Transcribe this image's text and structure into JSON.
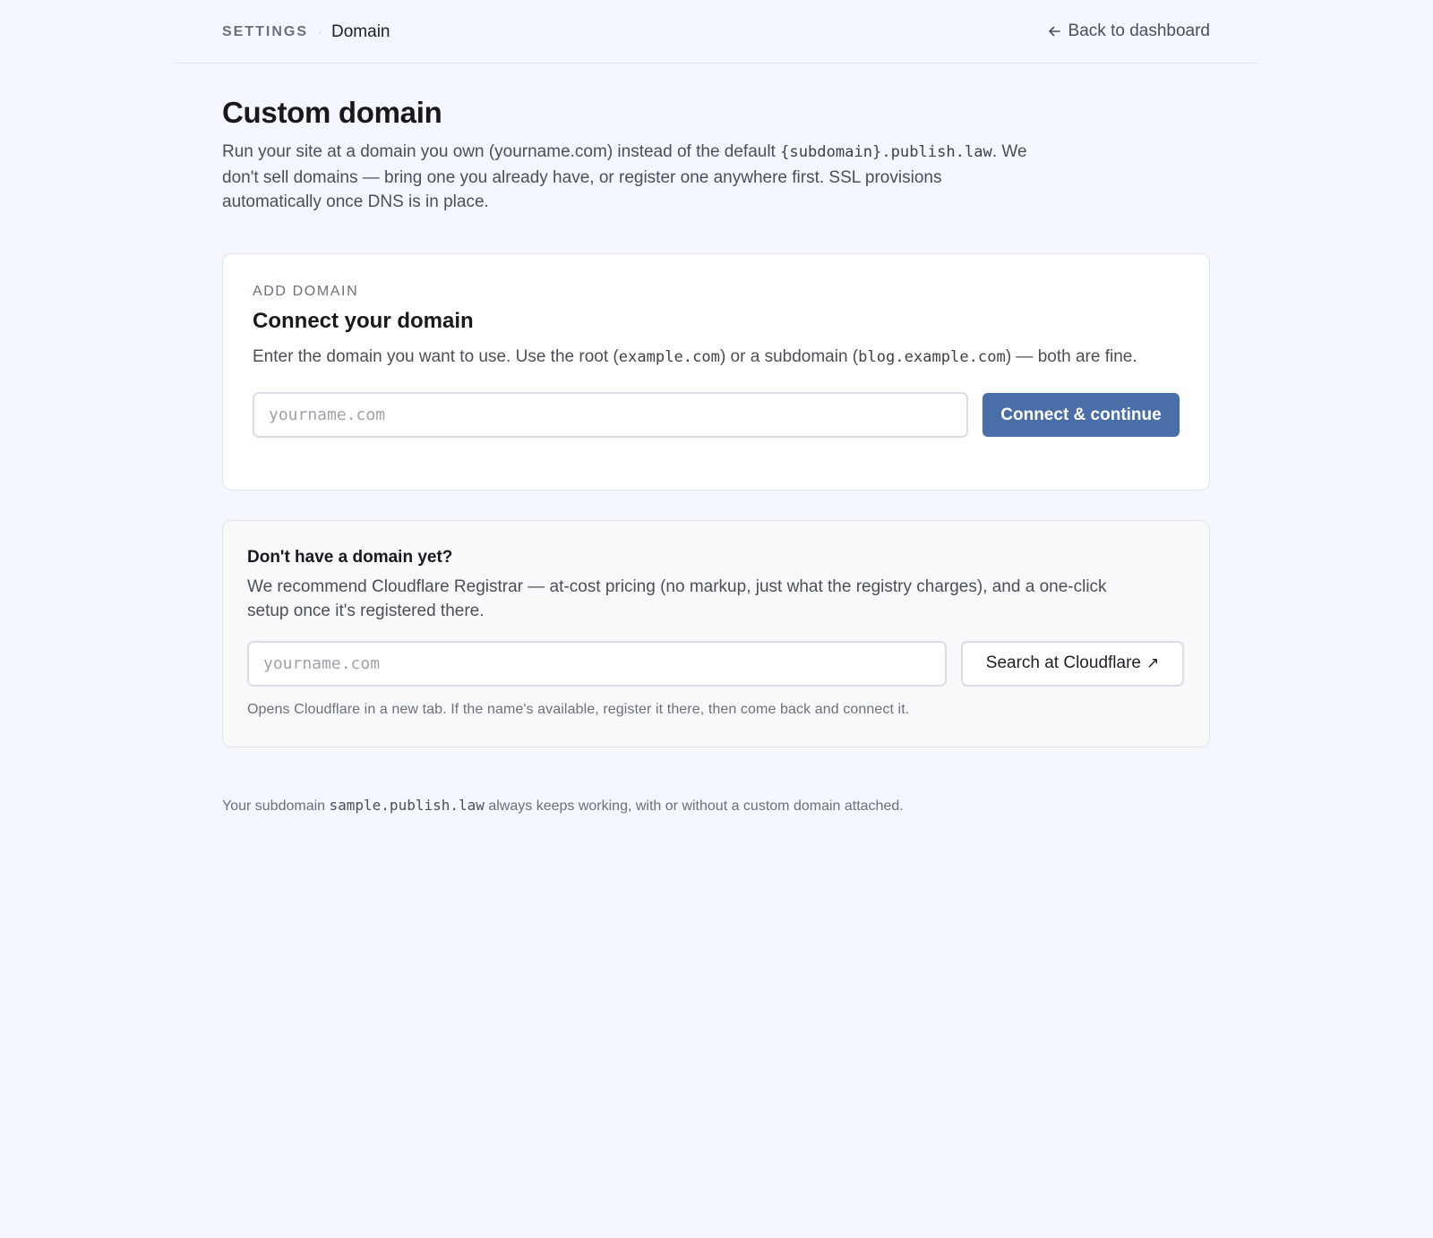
{
  "breadcrumb": {
    "section": "SETTINGS",
    "separator": "·",
    "current": "Domain"
  },
  "back_link": {
    "label": "Back to dashboard",
    "icon": "arrow-left-icon"
  },
  "page": {
    "title": "Custom domain",
    "intro_before": "Run your site at a domain you own (yourname.com) instead of the default ",
    "intro_code": "{subdomain}.publish.",
    "intro_code_tld": "law",
    "intro_after": ". We don't sell domains — bring one you already have, or register one anywhere first. SSL provisions automatically once DNS is in place."
  },
  "add_domain": {
    "eyebrow": "ADD DOMAIN",
    "title": "Connect your domain",
    "desc_1": "Enter the domain you want to use. Use the root (",
    "code_root": "example.com",
    "desc_2": ") or a subdomain (",
    "code_sub": "blog.example.com",
    "desc_3": ") — both are fine.",
    "input_placeholder": "yourname.com",
    "input_value": "",
    "button_label": "Connect & continue"
  },
  "registrar": {
    "title": "Don't have a domain yet?",
    "desc": "We recommend Cloudflare Registrar — at-cost pricing (no markup, just what the registry charges), and a one-click setup once it's registered there.",
    "input_placeholder": "yourname.com",
    "input_value": "",
    "button_label": "Search at Cloudflare",
    "button_icon": "↗",
    "hint": "Opens Cloudflare in a new tab. If the name's available, register it there, then come back and connect it."
  },
  "footnote": {
    "before": "Your subdomain ",
    "code": "sample.publish.",
    "code_tld": "law",
    "after": " always keeps working, with or without a custom domain attached."
  },
  "colors": {
    "background": "#f4f7fd",
    "primary_button": "#4a6ea8",
    "card": "#ffffff",
    "muted_card": "#f8f9fa"
  }
}
